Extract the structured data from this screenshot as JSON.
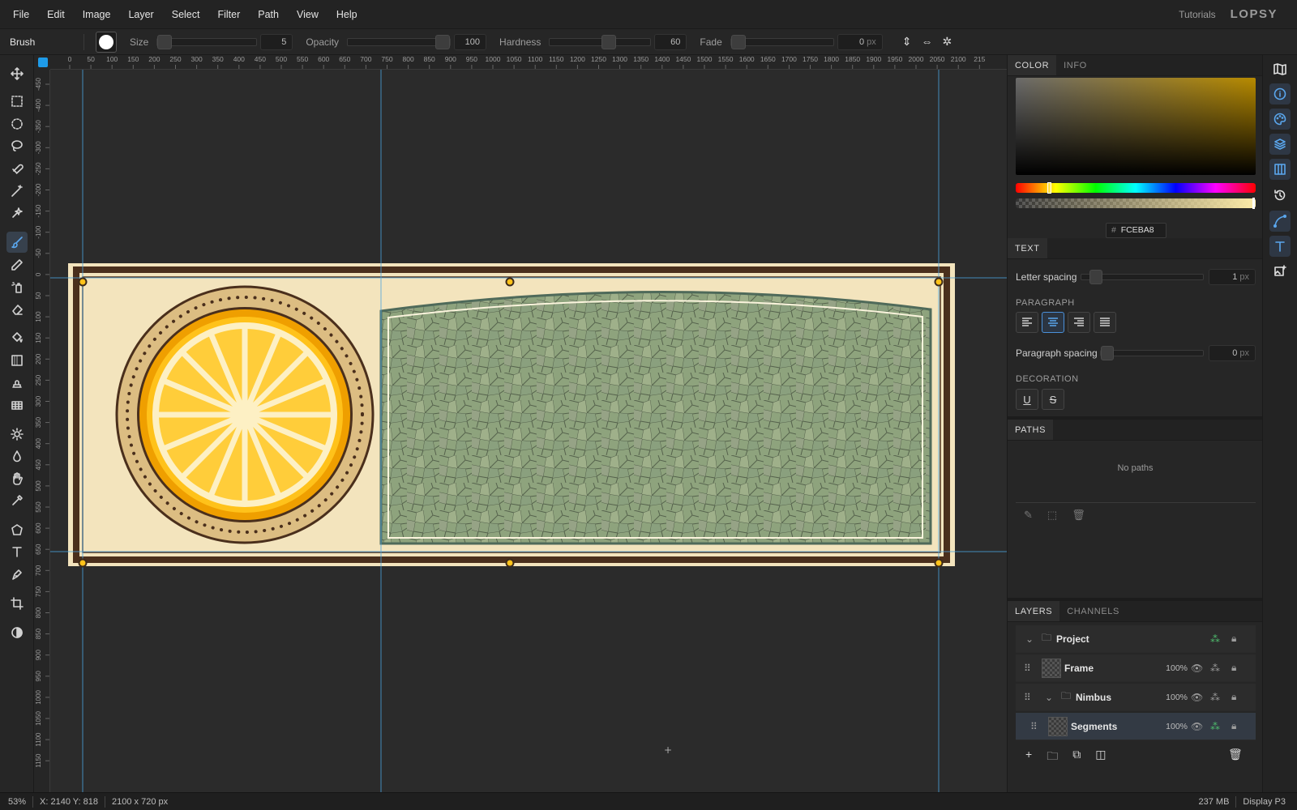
{
  "menu": {
    "items": [
      "File",
      "Edit",
      "Image",
      "Layer",
      "Select",
      "Filter",
      "Path",
      "View",
      "Help"
    ],
    "tutorials": "Tutorials",
    "logo": "LOPSY"
  },
  "options": {
    "tool": "Brush",
    "size": {
      "label": "Size",
      "value": "5"
    },
    "opacity": {
      "label": "Opacity",
      "value": "100"
    },
    "hardness": {
      "label": "Hardness",
      "value": "60"
    },
    "fade": {
      "label": "Fade",
      "value": "0",
      "unit": "px"
    }
  },
  "ruler": {
    "h_ticks": [
      "0",
      "50",
      "100",
      "150",
      "200",
      "250",
      "300",
      "350",
      "400",
      "450",
      "500",
      "550",
      "600",
      "650",
      "700",
      "750",
      "800",
      "850",
      "900",
      "950",
      "1000",
      "1050",
      "1100",
      "1150",
      "1200",
      "1250",
      "1300",
      "1350",
      "1400",
      "1450",
      "1500",
      "1550",
      "1600",
      "1650",
      "1700",
      "1750",
      "1800",
      "1850",
      "1900",
      "1950",
      "2000",
      "2050",
      "2100",
      "215"
    ],
    "v_ticks": [
      "-450",
      "-400",
      "-350",
      "-300",
      "-250",
      "-200",
      "-150",
      "-100",
      "-50",
      "0",
      "50",
      "100",
      "150",
      "200",
      "250",
      "300",
      "350",
      "400",
      "450",
      "500",
      "550",
      "600",
      "650",
      "700",
      "750",
      "800",
      "850",
      "900",
      "950",
      "1000",
      "1050",
      "1100",
      "1150"
    ]
  },
  "color_panel": {
    "tabs": [
      "COLOR",
      "INFO"
    ],
    "hex_prefix": "#",
    "hex": "FCEBA8",
    "hue_level": 0.14,
    "alpha_level": 1.0
  },
  "text_panel": {
    "tab": "TEXT",
    "letter_spacing": {
      "label": "Letter spacing",
      "value": "1",
      "unit": "px"
    },
    "paragraph_heading": "PARAGRAPH",
    "paragraph_spacing": {
      "label": "Paragraph spacing",
      "value": "0",
      "unit": "px"
    },
    "decoration_heading": "DECORATION",
    "underline": "U",
    "strike": "S"
  },
  "paths_panel": {
    "tab": "PATHS",
    "empty": "No paths"
  },
  "layers_panel": {
    "tabs": [
      "LAYERS",
      "CHANNELS"
    ],
    "rows": [
      {
        "name": "Project",
        "opacity": ""
      },
      {
        "name": "Frame",
        "opacity": "100%"
      },
      {
        "name": "Nimbus",
        "opacity": "100%"
      },
      {
        "name": "Segments",
        "opacity": "100%"
      }
    ]
  },
  "status": {
    "zoom": "53%",
    "coords": "X: 2140  Y: 818",
    "doc_size": "2100 x 720 px",
    "memory": "237 MB",
    "profile": "Display P3"
  },
  "colors": {
    "accent": "#1e9be8",
    "frame_dark": "#4a2f1c",
    "cream": "#f4e6c0",
    "lemon": "#ffcb2e",
    "mosaic": "#8fa47e"
  }
}
